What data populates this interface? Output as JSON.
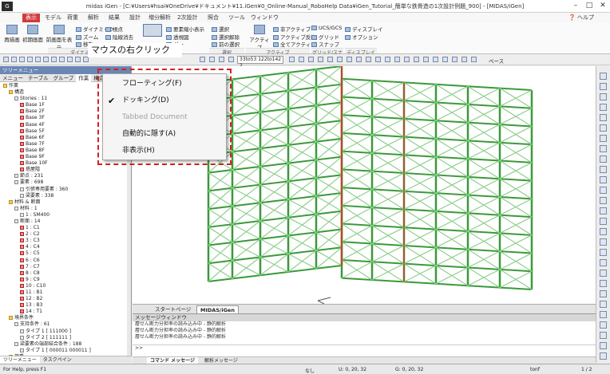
{
  "window": {
    "title": "midas iGen - [C:¥Users¥hsai¥OneDrive¥ドキュメント¥11.iGen¥0_Online-Manual_RoboHelp Data¥iGen_Tutorial_簡単な鉄骨造の1次設計例題_900] - [MIDAS/iGen]",
    "app_logo": "G"
  },
  "menu": {
    "items": [
      "表示",
      "モデル",
      "荷重",
      "解析",
      "結果",
      "設計",
      "増分解析",
      "2次設計",
      "照合",
      "ツール",
      "ウィンドウ"
    ],
    "active": "表示",
    "help": "ヘルプ"
  },
  "ribbon": {
    "big_buttons": [
      "再描画",
      "初期画面",
      "前画面を表示"
    ],
    "small_buttons": [
      "ダイナミック",
      "ズーム",
      "移動",
      "視点",
      "陰線消去"
    ],
    "group2": [
      "要素縮小表示",
      "透視図",
      "ダー"
    ],
    "group3": [
      "選択",
      "選択解除",
      "前の選択"
    ],
    "group4": [
      "アクティブ",
      "非アクティブ",
      "アクティブ反転",
      "全てアクティブ"
    ],
    "group5": [
      "UCS/GCS",
      "グリッド",
      "スナップ"
    ],
    "group6": [
      "ディスプレイ",
      "オプション"
    ],
    "group_labels": [
      "ダイナミックビュー",
      "選択",
      "アクティブ",
      "グリッド/スナップ",
      "ディスプレイ"
    ]
  },
  "toolstrip": {
    "coord": "33to53 122to142 2",
    "base_label": "ベース"
  },
  "left_panel": {
    "title": "ツリーメニュー",
    "tabs": [
      "メニュー",
      "テーブル",
      "グループ",
      "作業",
      "構造"
    ],
    "selected_tab": "作業",
    "tree": [
      {
        "t": "作業",
        "d": 0,
        "i": "fold"
      },
      {
        "t": "構造",
        "d": 1,
        "i": "fold"
      },
      {
        "t": "Stories : 11",
        "d": 2,
        "i": "n"
      },
      {
        "t": "Base 1F",
        "d": 3,
        "i": "red"
      },
      {
        "t": "Base 2F",
        "d": 3,
        "i": "red"
      },
      {
        "t": "Base 3F",
        "d": 3,
        "i": "red"
      },
      {
        "t": "Base 4F",
        "d": 3,
        "i": "red"
      },
      {
        "t": "Base 5F",
        "d": 3,
        "i": "red"
      },
      {
        "t": "Base 6F",
        "d": 3,
        "i": "red"
      },
      {
        "t": "Base 7F",
        "d": 3,
        "i": "red"
      },
      {
        "t": "Base 8F",
        "d": 3,
        "i": "red"
      },
      {
        "t": "Base 9F",
        "d": 3,
        "i": "red"
      },
      {
        "t": "Base 10F",
        "d": 3,
        "i": "red"
      },
      {
        "t": "塔屋階",
        "d": 3,
        "i": "red"
      },
      {
        "t": "節点 : 231",
        "d": 2,
        "i": "n"
      },
      {
        "t": "要素 : 698",
        "d": 2,
        "i": "n"
      },
      {
        "t": "引張専用要素 : 360",
        "d": 3,
        "i": "n"
      },
      {
        "t": "梁要素 : 338",
        "d": 3,
        "i": "n"
      },
      {
        "t": "材料 & 断面",
        "d": 1,
        "i": "fold"
      },
      {
        "t": "材料 : 1",
        "d": 2,
        "i": "n"
      },
      {
        "t": "1 : SM400",
        "d": 3,
        "i": "n"
      },
      {
        "t": "断面 : 14",
        "d": 2,
        "i": "n"
      },
      {
        "t": "1 : C1",
        "d": 3,
        "i": "red"
      },
      {
        "t": "2 : C2",
        "d": 3,
        "i": "red"
      },
      {
        "t": "3 : C3",
        "d": 3,
        "i": "red"
      },
      {
        "t": "4 : C4",
        "d": 3,
        "i": "red"
      },
      {
        "t": "5 : C5",
        "d": 3,
        "i": "red"
      },
      {
        "t": "6 : C6",
        "d": 3,
        "i": "red"
      },
      {
        "t": "7 : C7",
        "d": 3,
        "i": "red"
      },
      {
        "t": "8 : C8",
        "d": 3,
        "i": "red"
      },
      {
        "t": "9 : C9",
        "d": 3,
        "i": "red"
      },
      {
        "t": "10 : C10",
        "d": 3,
        "i": "red"
      },
      {
        "t": "11 : B1",
        "d": 3,
        "i": "red"
      },
      {
        "t": "12 : B2",
        "d": 3,
        "i": "red"
      },
      {
        "t": "13 : B3",
        "d": 3,
        "i": "red"
      },
      {
        "t": "14 : T1",
        "d": 3,
        "i": "red"
      },
      {
        "t": "境界条件",
        "d": 1,
        "i": "fold"
      },
      {
        "t": "支持条件 : 61",
        "d": 2,
        "i": "n"
      },
      {
        "t": "タイプ 1 [ 111000 ]",
        "d": 3,
        "i": "n"
      },
      {
        "t": "タイプ 2 [ 111111 ]",
        "d": 3,
        "i": "n"
      },
      {
        "t": "梁要素の端部結合条件 : 188",
        "d": 2,
        "i": "n"
      },
      {
        "t": "タイプ 1 [ 000011 000011 ]",
        "d": 3,
        "i": "n"
      },
      {
        "t": "荷重",
        "d": 1,
        "i": "fold"
      },
      {
        "t": "荷重を質量に変換 : 3",
        "d": 2,
        "i": "n"
      },
      {
        "t": "タイプ 1 [ DL : スケール=1 ]",
        "d": 3,
        "i": "n"
      }
    ],
    "bottom_tabs": [
      "ツリーメニュー",
      "タスクペイン"
    ]
  },
  "context_menu": {
    "items": [
      {
        "label": "フローティング(F)",
        "checked": false,
        "disabled": false
      },
      {
        "label": "ドッキング(D)",
        "checked": true,
        "disabled": false
      },
      {
        "label": "Tabbed Document",
        "checked": false,
        "disabled": true
      },
      {
        "label": "自動的に隠す(A)",
        "checked": false,
        "disabled": false
      },
      {
        "label": "非表示(H)",
        "checked": false,
        "disabled": false
      }
    ]
  },
  "callout": "マウスの右クリック",
  "doc_tabs": [
    "スタートページ",
    "MIDAS/iGen"
  ],
  "doc_tab_selected": "MIDAS/iGen",
  "message_window": {
    "title": "メッセージウィンドウ",
    "lines": [
      "層せん断力分担率の読み込み中 - 静的解析",
      "層せん断力分担率の読み込み中 - 静的解析",
      "層せん断力分担率の読み込み中 - 静的解析"
    ],
    "prompt": ">>",
    "tabs": [
      "コマンド メッセージ",
      "解析メッセージ"
    ]
  },
  "status": {
    "help": "For Help, press F1",
    "none": "なし",
    "u": "U: 0, 20, 32",
    "g": "G: 0, 20, 32",
    "unit": "tonf",
    "page": "1 / 2"
  }
}
